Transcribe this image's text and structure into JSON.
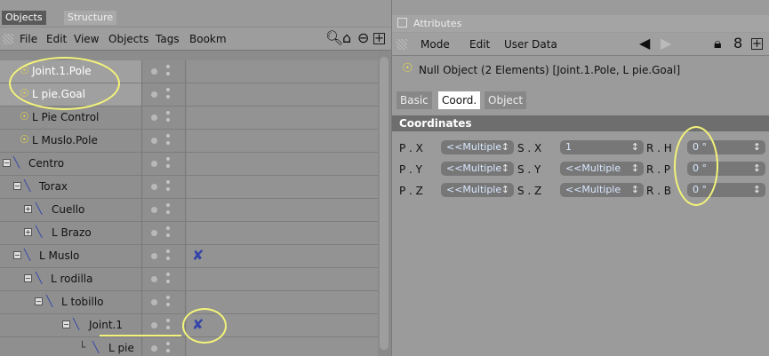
{
  "left_tabs": {
    "objects": "Objects",
    "structure": "Structure"
  },
  "menu": {
    "file": "File",
    "edit": "Edit",
    "view": "View",
    "objects": "Objects",
    "tags": "Tags",
    "bookmarks": "Bookm"
  },
  "tree": [
    {
      "label": "Joint.1.Pole",
      "icon": "null-object-icon"
    },
    {
      "label": "L pie.Goal",
      "icon": "null-object-icon"
    },
    {
      "label": "L Pie Control",
      "icon": "null-object-icon"
    },
    {
      "label": "L Muslo.Pole",
      "icon": "null-object-icon"
    },
    {
      "label": "Centro",
      "icon": "joint-icon"
    },
    {
      "label": "Torax",
      "icon": "joint-icon"
    },
    {
      "label": "Cuello",
      "icon": "joint-icon"
    },
    {
      "label": "L Brazo",
      "icon": "joint-icon"
    },
    {
      "label": "L Muslo",
      "icon": "joint-icon"
    },
    {
      "label": "L rodilla",
      "icon": "joint-icon"
    },
    {
      "label": "L tobillo",
      "icon": "joint-icon"
    },
    {
      "label": "Joint.1",
      "icon": "joint-icon"
    },
    {
      "label": "L pie",
      "icon": "joint-icon"
    }
  ],
  "attributes": {
    "header": "Attributes",
    "menu": {
      "mode": "Mode",
      "edit": "Edit",
      "user_data": "User Data"
    },
    "title": "Null Object (2 Elements) [Joint.1.Pole, L pie.Goal]",
    "tabs": {
      "basic": "Basic",
      "coord": "Coord.",
      "object": "Object"
    },
    "section": "Coordinates",
    "fields": {
      "px_label": "P . X",
      "px_val": "<<Multiple",
      "py_label": "P . Y",
      "py_val": "<<Multiple",
      "pz_label": "P . Z",
      "pz_val": "<<Multiple",
      "sx_label": "S . X",
      "sx_val": "1",
      "sy_label": "S . Y",
      "sy_val": "<<Multiple",
      "sz_label": "S . Z",
      "sz_val": "<<Multiple",
      "rh_label": "R . H",
      "rh_val": "0 °",
      "rp_label": "R . P",
      "rp_val": "0 °",
      "rb_label": "R . B",
      "rb_val": "0 °"
    }
  },
  "colors": {
    "highlight_circle": "#f3f37a",
    "active_tab": "#5a5a5a"
  }
}
